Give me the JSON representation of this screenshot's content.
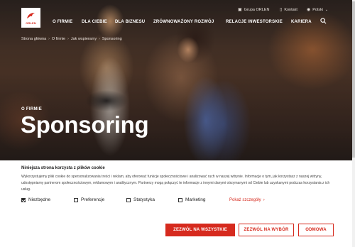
{
  "brand": {
    "logo_text": "ORLEN",
    "accent": "#d62a1e"
  },
  "utility": [
    {
      "label": "Grupa ORLEN",
      "icon": "building-icon"
    },
    {
      "label": "Kontakt",
      "icon": "phone-icon"
    },
    {
      "label": "Polski",
      "icon": "globe-icon",
      "chevron": "chevron-down-icon"
    }
  ],
  "nav": [
    "O FIRMIE",
    "DLA CIEBIE",
    "DLA BIZNESU",
    "ZRÓWNOWAŻONY ROZWÓJ",
    "RELACJE INWESTORSKIE",
    "KARIERA"
  ],
  "search_icon": "search-icon",
  "breadcrumb": [
    "Strona główna",
    "O firmie",
    "Jak wspieramy",
    "Sponsoring"
  ],
  "hero": {
    "label": "O FIRMIE",
    "title": "Sponsoring"
  },
  "cookie": {
    "title": "Niniejsza strona korzysta z plików cookie",
    "text": "Wykorzystujemy pliki cookie do spersonalizowania treści i reklam, aby oferować funkcje społecznościowe i analizować ruch w naszej witrynie. Informacje o tym, jak korzystasz z naszej witryny, udostępniamy partnerom społecznościowym, reklamowym i analitycznym. Partnerzy mogą połączyć te informacje z innymi danymi otrzymanymi od Ciebie lub uzyskanymi podczas korzystania z ich usług.",
    "options": [
      {
        "label": "Niezbędne",
        "checked": true
      },
      {
        "label": "Preferencje",
        "checked": false
      },
      {
        "label": "Statystyka",
        "checked": false
      },
      {
        "label": "Marketing",
        "checked": false
      }
    ],
    "details_link": "Pokaż szczegóły",
    "buttons": {
      "accept_all": "ZEZWÓL NA WSZYSTKIE",
      "accept_selected": "ZEZWÓL NA WYBÓR",
      "reject": "ODMOWA"
    }
  }
}
